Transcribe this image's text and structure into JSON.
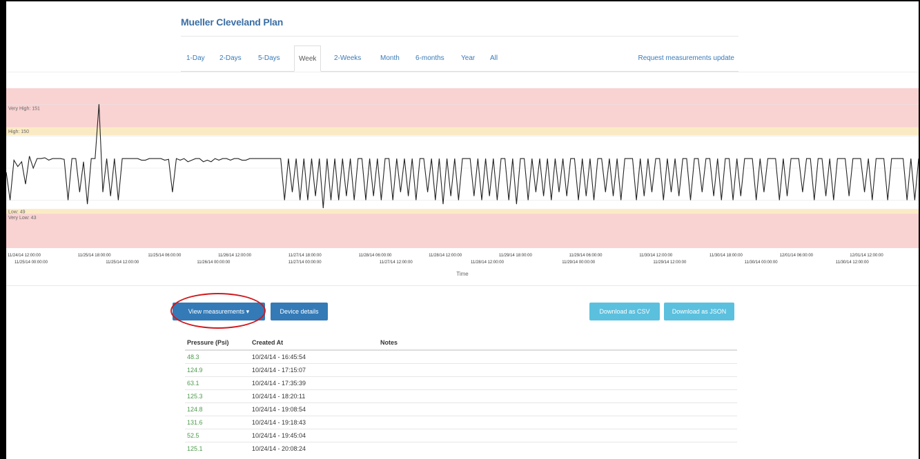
{
  "page": {
    "title": "Mueller Cleveland Plan"
  },
  "tabs": [
    {
      "label": "1-Day",
      "active": false
    },
    {
      "label": "2-Days",
      "active": false
    },
    {
      "label": "5-Days",
      "active": false
    },
    {
      "label": "Week",
      "active": true
    },
    {
      "label": "2-Weeks",
      "active": false
    },
    {
      "label": "Month",
      "active": false
    },
    {
      "label": "6-months",
      "active": false
    },
    {
      "label": "Year",
      "active": false
    },
    {
      "label": "All",
      "active": false
    }
  ],
  "tabs_right": {
    "label": "Request measurements update"
  },
  "chart_data": {
    "type": "line",
    "xlabel": "Time",
    "ylabel": "",
    "ylim": [
      0,
      200
    ],
    "bands": [
      {
        "label": "Very High: 151",
        "from": 151,
        "to": 200,
        "color": "#f9d2d2"
      },
      {
        "label": "High: 150",
        "from": 141,
        "to": 151,
        "color": "#fbebc4"
      },
      {
        "label": "Low: 49",
        "from": 43,
        "to": 49,
        "color": "#fbebc4"
      },
      {
        "label": "Very Low: 43",
        "from": 0,
        "to": 43,
        "color": "#f9d2d2"
      }
    ],
    "x_ticks_top": [
      "11/24/14 12:00:00",
      "11/25/14 18:00:00",
      "11/25/14 06:00:00",
      "11/26/14 12:00:00",
      "11/27/14 18:00:00",
      "11/28/14 06:00:00",
      "11/28/14 12:00:00",
      "11/29/14 18:00:00",
      "11/29/14 06:00:00",
      "11/30/14 12:00:00",
      "11/30/14 18:00:00",
      "12/01/14 06:00:00",
      "12/01/14 12:00:00"
    ],
    "x_ticks_bottom": [
      "11/25/14 00:00:00",
      "11/25/14 12:00:00",
      "11/26/14 00:00:00",
      "11/27/14 00:00:00",
      "11/27/14 12:00:00",
      "11/28/14 12:00:00",
      "11/29/14 00:00:00",
      "11/29/14 12:00:00",
      "11/30/14 00:00:00",
      "11/30/14 12:00:00"
    ],
    "series": [
      {
        "color": "#222222",
        "values": [
          95,
          60,
          110,
          102,
          108,
          80,
          115,
          100,
          112,
          112,
          113,
          110,
          112,
          112,
          112,
          111,
          60,
          112,
          112,
          70,
          108,
          55,
          112,
          112,
          180,
          70,
          112,
          65,
          112,
          60,
          112,
          112,
          112,
          112,
          112,
          110,
          110,
          112,
          112,
          112,
          112,
          110,
          111,
          70,
          112,
          110,
          112,
          108,
          110,
          112,
          112,
          108,
          110,
          108,
          112,
          110,
          112,
          112,
          110,
          112,
          112,
          110,
          110,
          112,
          112,
          112,
          112,
          112,
          112,
          112,
          112,
          112,
          60,
          112,
          70,
          112,
          60,
          112,
          60,
          112,
          65,
          112,
          50,
          112,
          60,
          112,
          60,
          112,
          65,
          112,
          60,
          112,
          112,
          60,
          112,
          65,
          112,
          60,
          112,
          112,
          60,
          112,
          70,
          112,
          65,
          112,
          60,
          112,
          112,
          70,
          112,
          60,
          112,
          55,
          112,
          65,
          112,
          60,
          112,
          112,
          112,
          65,
          112,
          60,
          112,
          65,
          112,
          60,
          112,
          112,
          60,
          112,
          55,
          112,
          112,
          60,
          112,
          70,
          112,
          65,
          112,
          60,
          112,
          70,
          112,
          65,
          112,
          112,
          60,
          112,
          65,
          112,
          60,
          112,
          112,
          70,
          112,
          65,
          112,
          60,
          112,
          112,
          112,
          60,
          112,
          65,
          112,
          70,
          112,
          112,
          60,
          112,
          70,
          112,
          65,
          112,
          112,
          60,
          112,
          112,
          70,
          112,
          112,
          65,
          112,
          60,
          112,
          112,
          60,
          112,
          65,
          112,
          112,
          112,
          60,
          112,
          70,
          112,
          112,
          112,
          60,
          112,
          65,
          112,
          112,
          112,
          70,
          112,
          112,
          60,
          112,
          112,
          65,
          112,
          60,
          112,
          112,
          112,
          65,
          112,
          112,
          112,
          70,
          112,
          60,
          112,
          112,
          112,
          60,
          112,
          112,
          112,
          112,
          60,
          112,
          60,
          112
        ]
      }
    ]
  },
  "buttons": {
    "view_measurements": "View measurements ▾",
    "device_details": "Device details",
    "download_csv": "Download as CSV",
    "download_json": "Download as JSON"
  },
  "table": {
    "headers": [
      "Pressure (Psi)",
      "Created At",
      "Notes"
    ],
    "rows": [
      [
        "48.3",
        "10/24/14 - 16:45:54",
        ""
      ],
      [
        "124.9",
        "10/24/14 - 17:15:07",
        ""
      ],
      [
        "63.1",
        "10/24/14 - 17:35:39",
        ""
      ],
      [
        "125.3",
        "10/24/14 - 18:20:11",
        ""
      ],
      [
        "124.8",
        "10/24/14 - 19:08:54",
        ""
      ],
      [
        "131.6",
        "10/24/14 - 19:18:43",
        ""
      ],
      [
        "52.5",
        "10/24/14 - 19:45:04",
        ""
      ],
      [
        "125.1",
        "10/24/14 - 20:08:24",
        ""
      ]
    ]
  }
}
